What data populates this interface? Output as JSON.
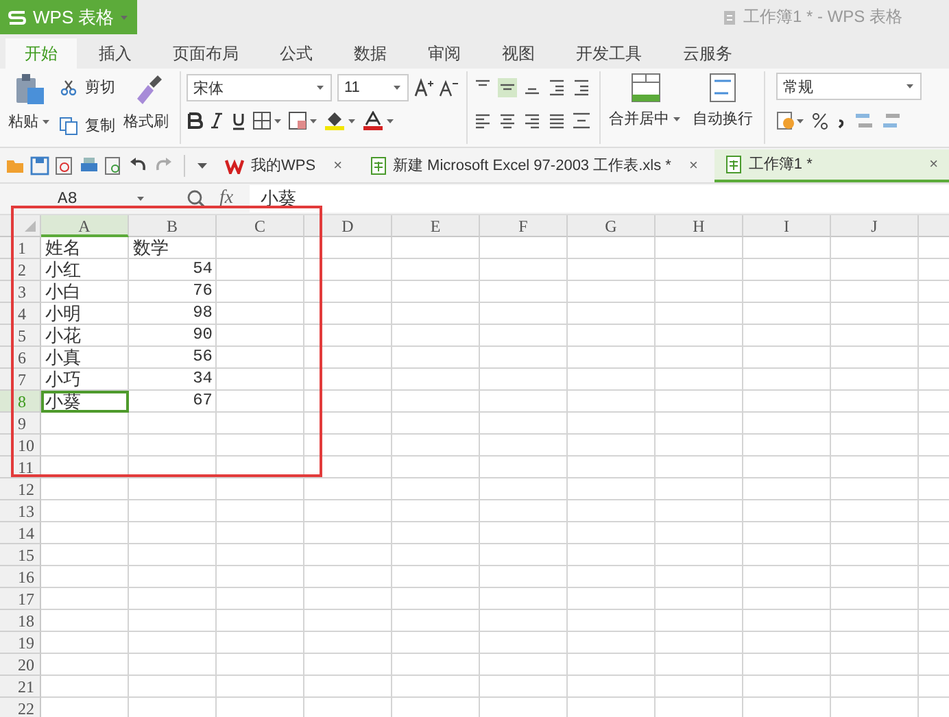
{
  "app_menu": {
    "label": "WPS 表格"
  },
  "window": {
    "title": "工作簿1 * - WPS 表格"
  },
  "ribbon_tabs": [
    {
      "label": "开始",
      "selected": true
    },
    {
      "label": "插入",
      "selected": false
    },
    {
      "label": "页面布局",
      "selected": false
    },
    {
      "label": "公式",
      "selected": false
    },
    {
      "label": "数据",
      "selected": false
    },
    {
      "label": "审阅",
      "selected": false
    },
    {
      "label": "视图",
      "selected": false
    },
    {
      "label": "开发工具",
      "selected": false
    },
    {
      "label": "云服务",
      "selected": false
    }
  ],
  "ribbon": {
    "paste": "粘贴",
    "cut": "剪切",
    "copy": "复制",
    "format_painter": "格式刷",
    "font": "宋体",
    "font_size": "11",
    "merge": "合并居中",
    "wrap": "自动换行",
    "number_format": "常规"
  },
  "doc_tabs": [
    {
      "label": "我的WPS",
      "kind": "home",
      "selected": false,
      "close": "×"
    },
    {
      "label": "新建 Microsoft Excel 97-2003 工作表.xls *",
      "kind": "sheet",
      "selected": false,
      "close": "×"
    },
    {
      "label": "工作簿1 *",
      "kind": "sheet",
      "selected": true,
      "close": "×"
    }
  ],
  "formula_bar": {
    "cell": "A8",
    "function_label": "fx",
    "value": "小葵"
  },
  "sheet": {
    "columns": [
      {
        "label": "A",
        "selected": true
      },
      {
        "label": "B",
        "selected": false
      },
      {
        "label": "C",
        "selected": false
      },
      {
        "label": "D",
        "selected": false
      },
      {
        "label": "E",
        "selected": false
      },
      {
        "label": "F",
        "selected": false
      },
      {
        "label": "G",
        "selected": false
      },
      {
        "label": "H",
        "selected": false
      },
      {
        "label": "I",
        "selected": false
      },
      {
        "label": "J",
        "selected": false
      }
    ],
    "rows": [
      {
        "number": "1",
        "selected": false,
        "cells": [
          {
            "text": "姓名",
            "kind": "text"
          },
          {
            "text": "数学",
            "kind": "text"
          }
        ]
      },
      {
        "number": "2",
        "selected": false,
        "cells": [
          {
            "text": "小红",
            "kind": "text"
          },
          {
            "text": "54",
            "kind": "number"
          }
        ]
      },
      {
        "number": "3",
        "selected": false,
        "cells": [
          {
            "text": "小白",
            "kind": "text"
          },
          {
            "text": "76",
            "kind": "number"
          }
        ]
      },
      {
        "number": "4",
        "selected": false,
        "cells": [
          {
            "text": "小明",
            "kind": "text"
          },
          {
            "text": "98",
            "kind": "number"
          }
        ]
      },
      {
        "number": "5",
        "selected": false,
        "cells": [
          {
            "text": "小花",
            "kind": "text"
          },
          {
            "text": "90",
            "kind": "number"
          }
        ]
      },
      {
        "number": "6",
        "selected": false,
        "cells": [
          {
            "text": "小真",
            "kind": "text"
          },
          {
            "text": "56",
            "kind": "number"
          }
        ]
      },
      {
        "number": "7",
        "selected": false,
        "cells": [
          {
            "text": "小巧",
            "kind": "text"
          },
          {
            "text": "34",
            "kind": "number"
          }
        ]
      },
      {
        "number": "8",
        "selected": true,
        "cells": [
          {
            "text": "小葵",
            "kind": "text"
          },
          {
            "text": "67",
            "kind": "number"
          }
        ]
      },
      {
        "number": "9",
        "selected": false,
        "cells": []
      },
      {
        "number": "10",
        "selected": false,
        "cells": []
      },
      {
        "number": "11",
        "selected": false,
        "cells": []
      },
      {
        "number": "12",
        "selected": false,
        "cells": []
      },
      {
        "number": "13",
        "selected": false,
        "cells": []
      },
      {
        "number": "14",
        "selected": false,
        "cells": []
      },
      {
        "number": "15",
        "selected": false,
        "cells": []
      },
      {
        "number": "16",
        "selected": false,
        "cells": []
      },
      {
        "number": "17",
        "selected": false,
        "cells": []
      },
      {
        "number": "18",
        "selected": false,
        "cells": []
      },
      {
        "number": "19",
        "selected": false,
        "cells": []
      },
      {
        "number": "20",
        "selected": false,
        "cells": []
      },
      {
        "number": "21",
        "selected": false,
        "cells": []
      },
      {
        "number": "22",
        "selected": false,
        "cells": []
      }
    ]
  }
}
